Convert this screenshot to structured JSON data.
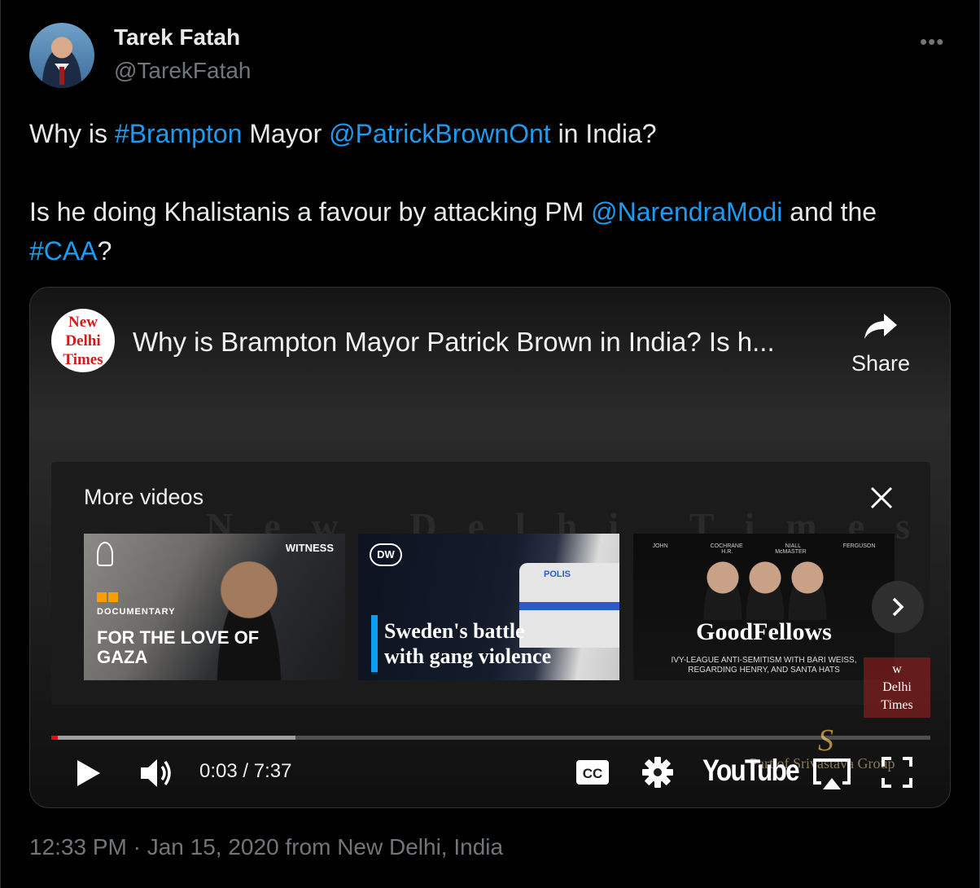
{
  "author": {
    "display_name": "Tarek Fatah",
    "handle": "@TarekFatah",
    "more_icon": "more-horizontal-icon"
  },
  "tweet": {
    "line1": {
      "t1": "Why is ",
      "hashtag_brampton": "#Brampton",
      "t2": " Mayor ",
      "mention_patrick": "@PatrickBrownOnt",
      "t3": " in India?"
    },
    "line2": {
      "t1": "Is he doing Khalistanis a favour by attacking PM ",
      "mention_modi": "@NarendraModi",
      "t2": " and the ",
      "hashtag_caa": "#CAA",
      "t3": "?"
    }
  },
  "video": {
    "channel_logo": {
      "line1": "New",
      "line2": "Delhi",
      "line3": "Times"
    },
    "title": "Why is Brampton Mayor Patrick Brown in India? Is h...",
    "share_label": "Share",
    "more_videos": {
      "title": "More videos",
      "watermark": "New Delhi Times",
      "items": [
        {
          "badge": "DOCUMENTARY",
          "title": "FOR THE LOVE OF GAZA",
          "tag": "WITNESS"
        },
        {
          "logo": "DW",
          "title_line1": "Sweden's battle",
          "title_line2": "with gang violence",
          "car_text": "POLIS"
        },
        {
          "names": "JOHN COCHRANE NIALL FERGUSON H.R. McMASTER",
          "title": "GoodFellows",
          "subtitle_line1": "IVY-LEAGUE ANTI-SEMITISM WITH BARI WEISS,",
          "subtitle_line2": "REGARDING HENRY, AND SANTA HATS"
        }
      ]
    },
    "overlay_badge": {
      "line1": "w",
      "line2": "Delhi",
      "line3": "Times"
    },
    "seal": {
      "mark": "S",
      "text": "Part of Srivastava Group"
    },
    "progress": {
      "played_fraction": 0.007,
      "buffered_fraction": 0.278
    },
    "time": "0:03 / 7:37",
    "brand": "YouTube",
    "colors": {
      "accent": "#1d9bf0",
      "progress": "#ff0000"
    }
  },
  "timestamp": "12:33 PM · Jan 15, 2020 from New Delhi, India"
}
